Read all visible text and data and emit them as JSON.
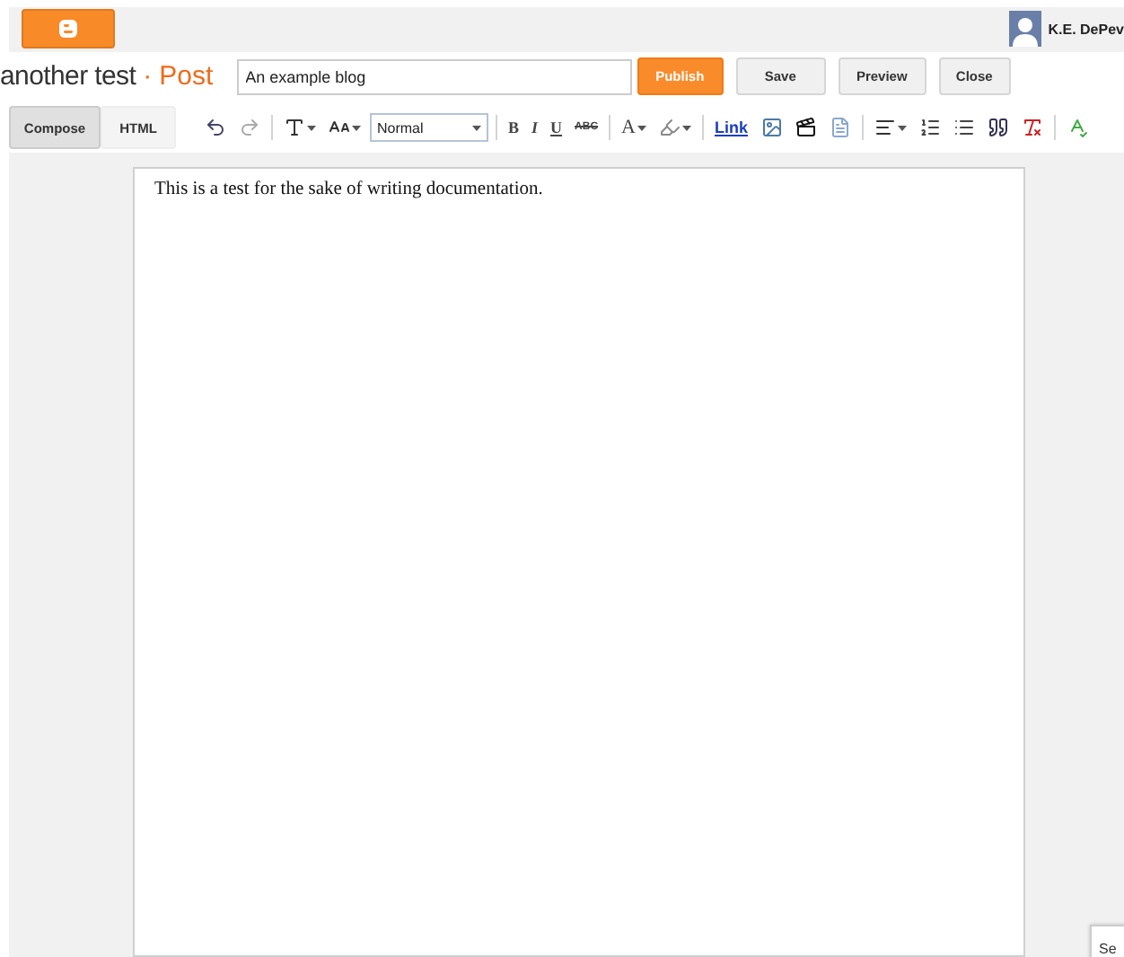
{
  "header": {
    "user_name": "K.E. DePev"
  },
  "post_bar": {
    "blog_name": "another test",
    "separator": "·",
    "section": "Post",
    "title_field": {
      "value": "An example blog"
    },
    "buttons": [
      {
        "label": "Publish",
        "kind": "primary"
      },
      {
        "label": "Save",
        "kind": "plain"
      },
      {
        "label": "Preview",
        "kind": "plain"
      },
      {
        "label": "Close",
        "kind": "plain"
      }
    ]
  },
  "mode_tabs": [
    {
      "label": "Compose",
      "selected": true
    },
    {
      "label": "HTML",
      "selected": false
    }
  ],
  "toolbar": {
    "items": [
      {
        "kind": "undo"
      },
      {
        "kind": "redo"
      },
      {
        "kind": "divider"
      },
      {
        "kind": "font"
      },
      {
        "kind": "font_size"
      },
      {
        "kind": "format_select",
        "value": "Normal"
      },
      {
        "kind": "divider"
      },
      {
        "kind": "bold",
        "label": "B"
      },
      {
        "kind": "italic",
        "label": "I"
      },
      {
        "kind": "underline",
        "label": "U"
      },
      {
        "kind": "strike",
        "label": "ABC"
      },
      {
        "kind": "divider"
      },
      {
        "kind": "text_color",
        "label": "A"
      },
      {
        "kind": "highlight"
      },
      {
        "kind": "divider"
      },
      {
        "kind": "link",
        "label": "Link"
      },
      {
        "kind": "image"
      },
      {
        "kind": "video"
      },
      {
        "kind": "jump_break"
      },
      {
        "kind": "divider"
      },
      {
        "kind": "align"
      },
      {
        "kind": "numbered_list"
      },
      {
        "kind": "bullet_list"
      },
      {
        "kind": "quote"
      },
      {
        "kind": "clear_format"
      },
      {
        "kind": "divider"
      },
      {
        "kind": "spell_check"
      }
    ]
  },
  "editor": {
    "text": "This is a test for the sake of writing documentation."
  },
  "corner_popup": {
    "text": "Se"
  }
}
